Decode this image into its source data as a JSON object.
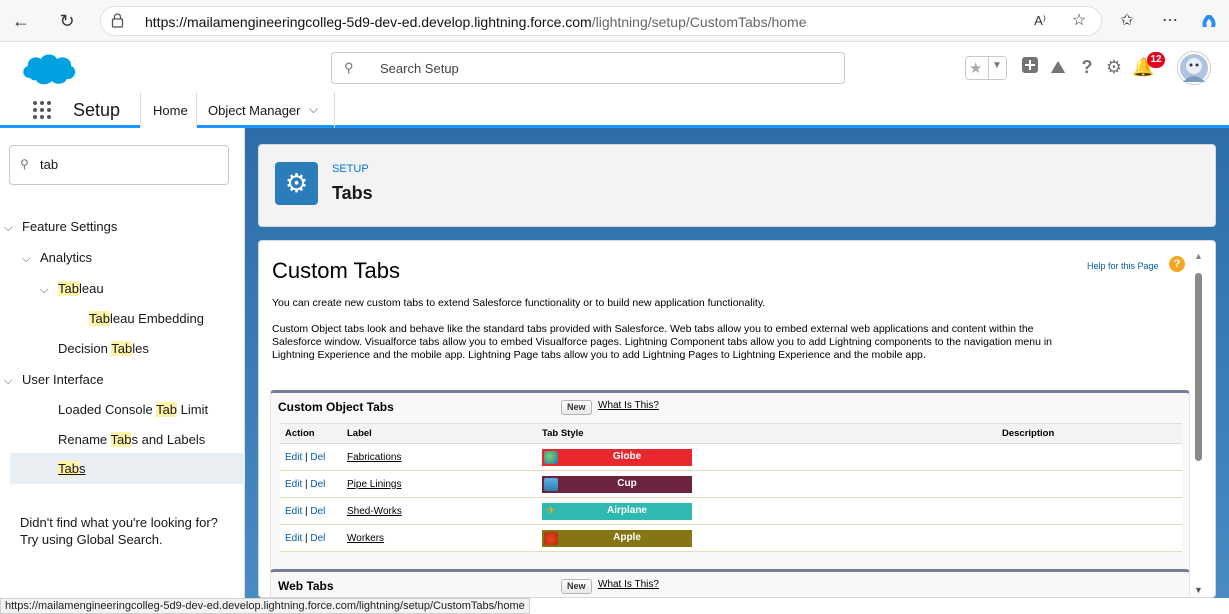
{
  "browser": {
    "url_host": "https://mailamengineeringcolleg-5d9-dev-ed.develop.lightning.force.com",
    "url_path": "/lightning/setup/CustomTabs/home",
    "status_url": "https://mailamengineeringcolleg-5d9-dev-ed.develop.lightning.force.com/lightning/setup/CustomTabs/home"
  },
  "header": {
    "search_placeholder": "Search Setup",
    "notification_count": "12"
  },
  "context_nav": {
    "app_name": "Setup",
    "tabs": [
      {
        "label": "Home"
      },
      {
        "label": "Object Manager"
      }
    ]
  },
  "sidebar": {
    "quick_find_value": "tab",
    "items": {
      "feature_settings": "Feature Settings",
      "analytics": "Analytics",
      "tableau_hl": "Tab",
      "tableau_rest": "leau",
      "tableau_emb_hl": "Tab",
      "tableau_emb_rest": "leau Embedding",
      "decision_pre": "Decision ",
      "decision_hl": "Tab",
      "decision_post": "les",
      "user_interface": "User Interface",
      "loaded_pre": "Loaded Console ",
      "loaded_hl": "Tab",
      "loaded_post": " Limit",
      "rename_pre": "Rename ",
      "rename_hl": "Tab",
      "rename_post": "s and Labels",
      "tabs_hl": "Tab",
      "tabs_post": "s"
    },
    "help_line1": "Didn't find what you're looking for?",
    "help_line2": "Try using Global Search."
  },
  "setup_header": {
    "eyebrow": "SETUP",
    "title": "Tabs"
  },
  "content": {
    "title": "Custom Tabs",
    "help_link": "Help for this Page",
    "para1": "You can create new custom tabs to extend Salesforce functionality or to build new application functionality.",
    "para2_l1": "Custom Object tabs look and behave like the standard tabs provided with Salesforce. Web tabs allow you to embed external web applications and content within the",
    "para2_l2": "Salesforce window. Visualforce tabs allow you to embed Visualforce pages. Lightning Component tabs allow you to add Lightning components to the navigation menu in",
    "para2_l3": "Lightning Experience and the mobile app. Lightning Page tabs allow you to add Lightning Pages to Lightning Experience and the mobile app."
  },
  "custom_object_tabs": {
    "title": "Custom Object Tabs",
    "new_label": "New",
    "what_label": "What Is This?",
    "columns": [
      "Action",
      "Label",
      "Tab Style",
      "Description"
    ],
    "edit_label": "Edit",
    "del_label": "Del",
    "rows": [
      {
        "label": "Fabrications",
        "style": "Globe",
        "color": "#e8272e",
        "icon": "globe-icon"
      },
      {
        "label": "Pipe Linings",
        "style": "Cup",
        "color": "#6b2340",
        "icon": "cup-icon"
      },
      {
        "label": "Shed-Works",
        "style": "Airplane",
        "color": "#2fb9b1",
        "icon": "airplane-icon"
      },
      {
        "label": "Workers",
        "style": "Apple",
        "color": "#867513",
        "icon": "apple-icon"
      }
    ]
  },
  "web_tabs": {
    "title": "Web Tabs",
    "new_label": "New",
    "what_label": "What Is This?"
  }
}
